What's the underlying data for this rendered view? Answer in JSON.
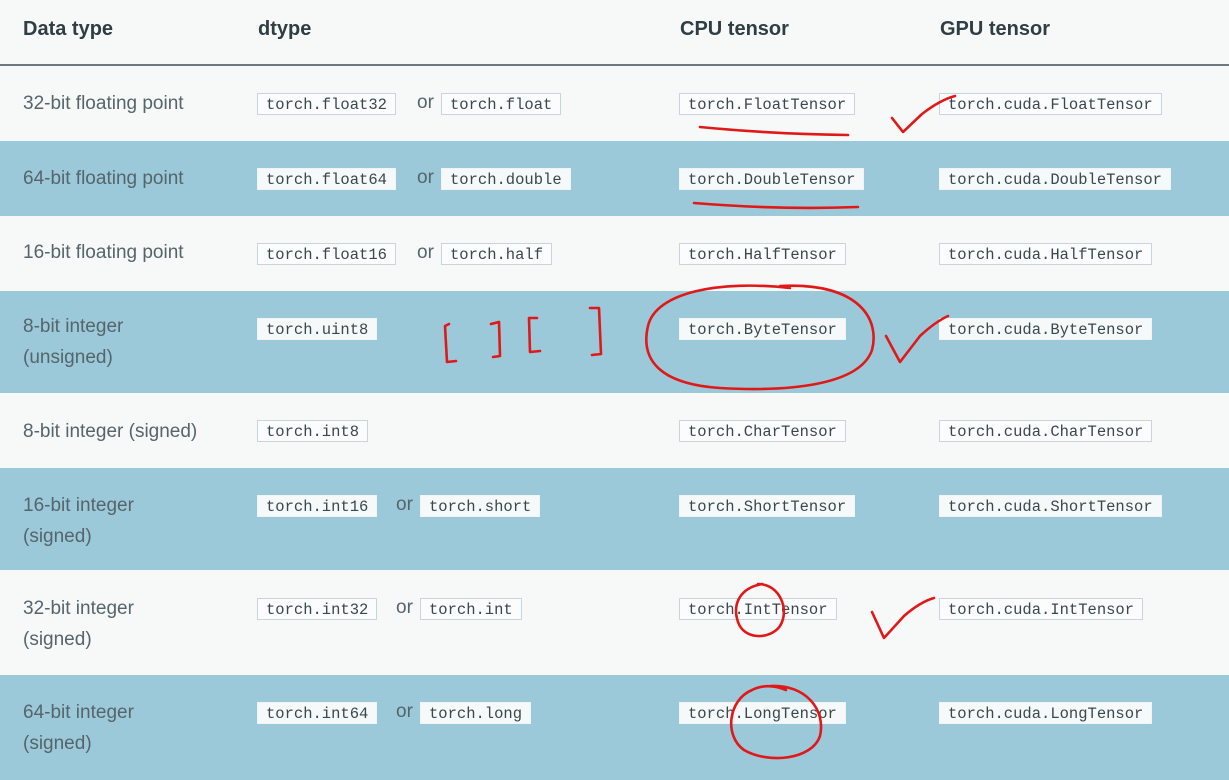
{
  "header": {
    "col_data_type": "Data type",
    "col_dtype": "dtype",
    "col_cpu": "CPU tensor",
    "col_gpu": "GPU tensor"
  },
  "rows": [
    {
      "data_type_line1": "32-bit floating point",
      "data_type_line2": "",
      "dtype_a": "torch.float32",
      "or": "or",
      "dtype_b": "torch.float",
      "cpu": "torch.FloatTensor",
      "gpu": "torch.cuda.FloatTensor"
    },
    {
      "data_type_line1": "64-bit floating point",
      "data_type_line2": "",
      "dtype_a": "torch.float64",
      "or": "or",
      "dtype_b": "torch.double",
      "cpu": "torch.DoubleTensor",
      "gpu": "torch.cuda.DoubleTensor"
    },
    {
      "data_type_line1": "16-bit floating point",
      "data_type_line2": "",
      "dtype_a": "torch.float16",
      "or": "or",
      "dtype_b": "torch.half",
      "cpu": "torch.HalfTensor",
      "gpu": "torch.cuda.HalfTensor"
    },
    {
      "data_type_line1": "8-bit integer",
      "data_type_line2": "(unsigned)",
      "dtype_a": "torch.uint8",
      "or": "",
      "dtype_b": "",
      "cpu": "torch.ByteTensor",
      "gpu": "torch.cuda.ByteTensor"
    },
    {
      "data_type_line1": "8-bit integer (signed)",
      "data_type_line2": "",
      "dtype_a": "torch.int8",
      "or": "",
      "dtype_b": "",
      "cpu": "torch.CharTensor",
      "gpu": "torch.cuda.CharTensor"
    },
    {
      "data_type_line1": "16-bit integer",
      "data_type_line2": "(signed)",
      "dtype_a": "torch.int16",
      "or": "or",
      "dtype_b": "torch.short",
      "cpu": "torch.ShortTensor",
      "gpu": "torch.cuda.ShortTensor"
    },
    {
      "data_type_line1": "32-bit integer",
      "data_type_line2": "(signed)",
      "dtype_a": "torch.int32",
      "or": "or",
      "dtype_b": "torch.int",
      "cpu": "torch.IntTensor",
      "gpu": "torch.cuda.IntTensor"
    },
    {
      "data_type_line1": "64-bit integer",
      "data_type_line2": "(signed)",
      "dtype_a": "torch.int64",
      "or": "or",
      "dtype_b": "torch.long",
      "cpu": "torch.LongTensor",
      "gpu": "torch.cuda.LongTensor"
    }
  ],
  "colors": {
    "row_light": "#f7f8f8",
    "row_blue": "#9bc9d9",
    "annotation_ink": "#e01818"
  }
}
